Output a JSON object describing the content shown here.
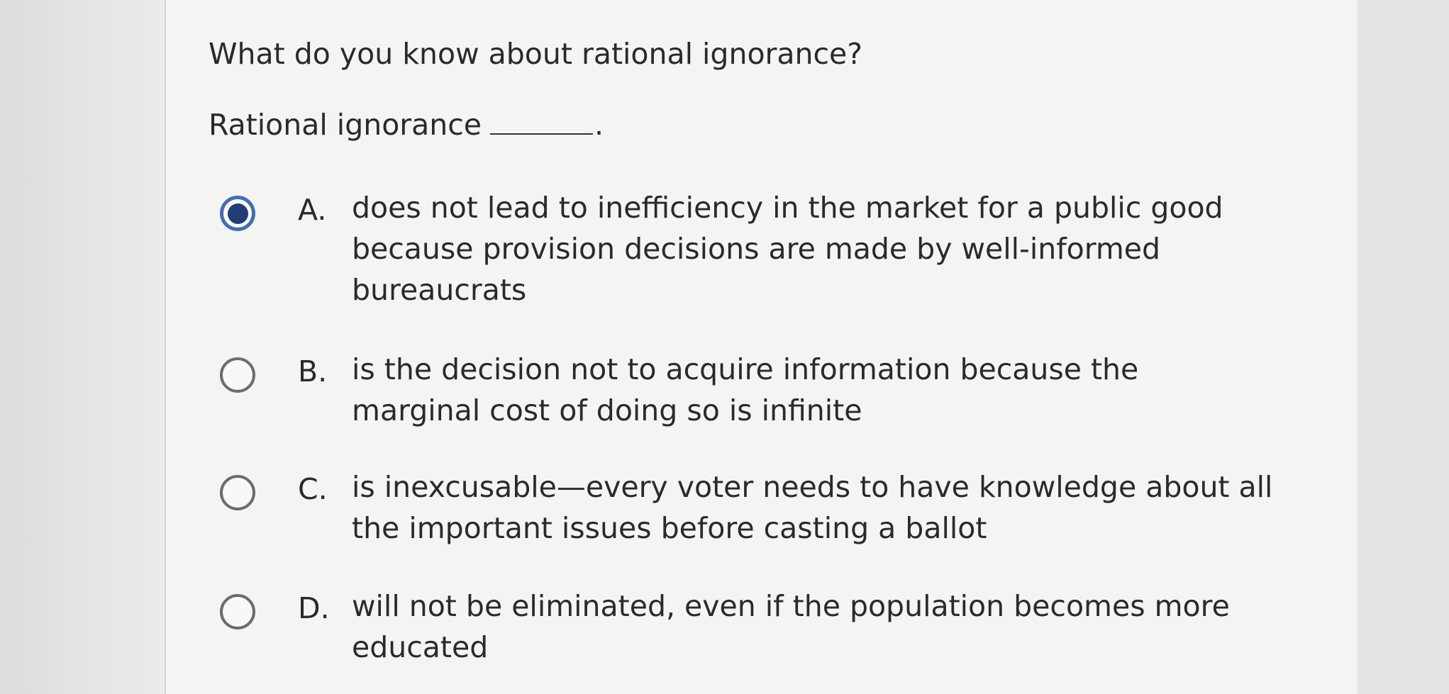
{
  "question": {
    "prompt": "What do you know about rational ignorance?",
    "stem": "Rational ignorance",
    "stem_end": "."
  },
  "options": [
    {
      "letter": "A.",
      "text": "does not lead to inefficiency in the market for a public good because provision decisions are made by well-informed bureaucrats",
      "selected": true
    },
    {
      "letter": "B.",
      "text": "is the decision not to acquire information because the marginal cost of doing so is infinite",
      "selected": false
    },
    {
      "letter": "C.",
      "text": "is inexcusable—every voter needs to have knowledge about all the important issues before casting a ballot",
      "selected": false
    },
    {
      "letter": "D.",
      "text": "will not be eliminated, even if the population becomes more educated",
      "selected": false
    }
  ],
  "colors": {
    "selected_ring": "#3f6fb2",
    "selected_dot": "#1f3e73",
    "unselected_ring": "#6c6c6c",
    "text": "#2a2a2a"
  }
}
